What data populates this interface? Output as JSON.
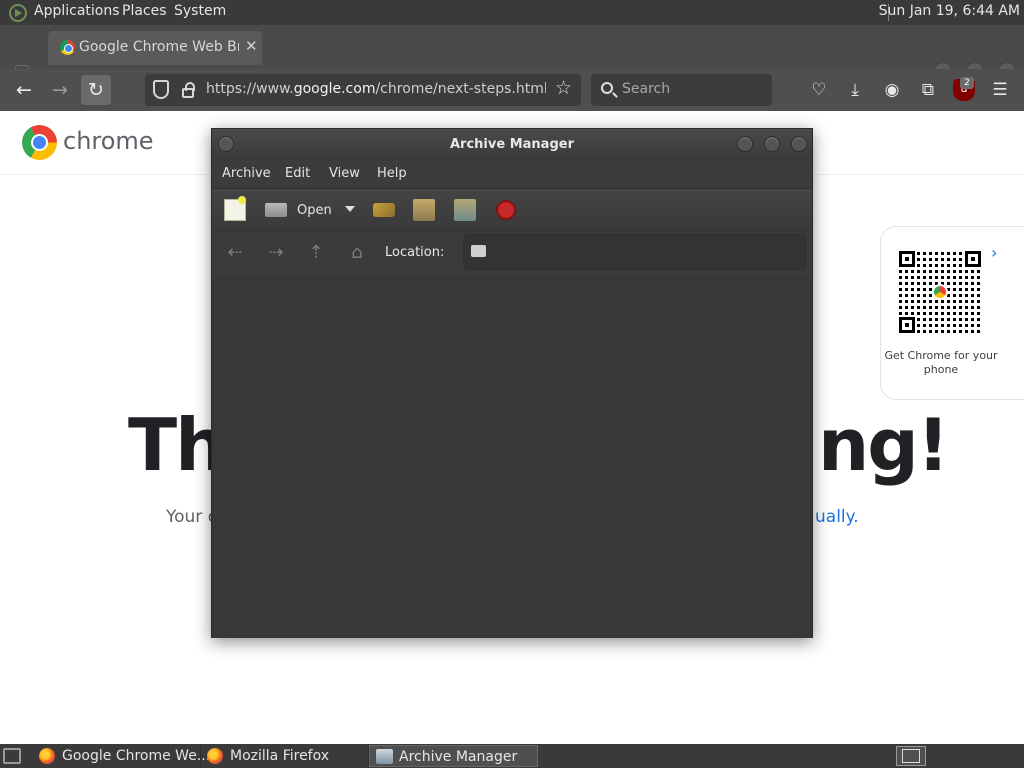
{
  "top_panel": {
    "menus": [
      "Applications",
      "Places",
      "System"
    ],
    "clock": "Sun Jan 19,  6:44 AM"
  },
  "firefox": {
    "tab": {
      "title": "Google Chrome Web Browser"
    },
    "url": {
      "prefix": "https://www.",
      "domain": "google.com",
      "path": "/chrome/next-steps.html?sta"
    },
    "search_placeholder": "Search",
    "ublock_badge": "2"
  },
  "page": {
    "brand": "chrome",
    "headline_left": "Th",
    "headline_right": "ng!",
    "sub_left": "Your c",
    "sub_right": "ually.",
    "qr_text": "Get Chrome for your phone"
  },
  "archive_manager": {
    "title": "Archive Manager",
    "menus": [
      "Archive",
      "Edit",
      "View",
      "Help"
    ],
    "open_label": "Open",
    "location_label": "Location:"
  },
  "taskbar": {
    "tasks": [
      "Google Chrome We...",
      "Mozilla Firefox",
      "Archive Manager"
    ]
  },
  "colors": {
    "panel": "#3a3a3a",
    "am_background": "#383838",
    "link_blue": "#1a73e8"
  }
}
